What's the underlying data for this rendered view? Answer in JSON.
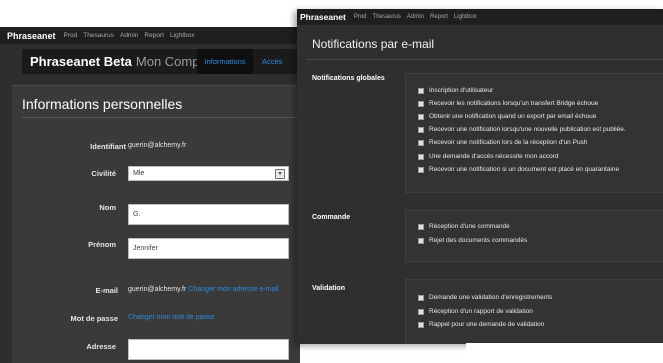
{
  "account_window": {
    "nav": {
      "brand": "Phraseanet",
      "items": [
        "Prod",
        "Thesaurus",
        "Admin",
        "Report",
        "Lightbox"
      ]
    },
    "title": {
      "app": "Phraseanet Beta",
      "page": "Mon Compte"
    },
    "tabs": [
      "Informations",
      "Accès"
    ],
    "section_title": "Informations personnelles",
    "fields": {
      "identifiant": {
        "label": "Identifiant",
        "value": "guerin@alchemy.fr"
      },
      "civilite": {
        "label": "Civilité",
        "value": "Mle"
      },
      "nom": {
        "label": "Nom",
        "value": "G."
      },
      "prenom": {
        "label": "Prénom",
        "value": "Jennifer"
      },
      "email": {
        "label": "E-mail",
        "value": "guerin@alchemy.fr",
        "link": "Changer mon adresse e-mail"
      },
      "password": {
        "label": "Mot de passe",
        "link": "Changer mon mot de passe"
      },
      "adresse": {
        "label": "Adresse",
        "value": ""
      }
    }
  },
  "notif_window": {
    "nav": {
      "brand": "Phraseanet",
      "items": [
        "Prod",
        "Thesaurus",
        "Admin",
        "Report",
        "Lightbox"
      ]
    },
    "title": "Notifications par e-mail",
    "sections": [
      {
        "label": "Notifications globales",
        "options": [
          "Inscription d'utilisateur",
          "Recevoir les notifications lorsqu'un transfert Bridge échoue",
          "Obtenir une notification quand un export par email échoue",
          "Recevoir une notification lorsqu'une nouvelle publication est publiée.",
          "Recevoir une notification lors de la réception d'un Push",
          "Une demande d'accès nécessite mon accord",
          "Recevoir une notification si un document est placé en quarantaine"
        ]
      },
      {
        "label": "Commande",
        "options": [
          "Réception d'une commande",
          "Rejet des documents commandés"
        ]
      },
      {
        "label": "Validation",
        "options": [
          "Demande une validation d'enregistrements",
          "Réception d'un rapport de validation",
          "Rappel pour une demande de validation"
        ]
      }
    ]
  },
  "colors": {
    "link": "#2c8be0",
    "panel_bg": "#2f2f2f",
    "nav_bg": "#1f1f1f"
  },
  "icons": {
    "select_arrow": "chevron-down-icon",
    "checkbox": "checkbox-icon"
  }
}
